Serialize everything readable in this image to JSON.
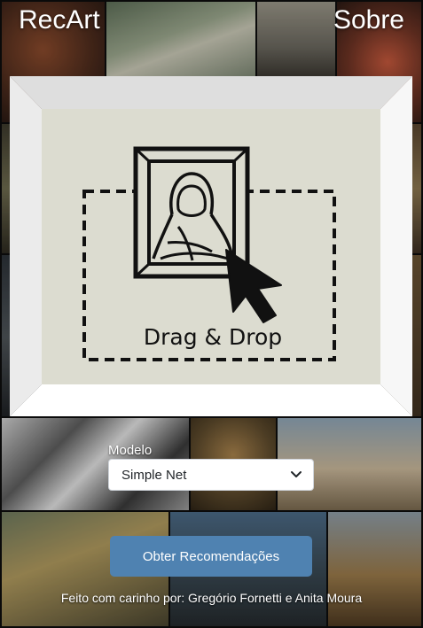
{
  "header": {
    "brand": "RecArt",
    "about_link": "Sobre"
  },
  "drop_zone": {
    "label": "Drag & Drop",
    "icon": "framed-portrait-with-cursor-icon"
  },
  "form": {
    "model_label": "Modelo",
    "model_selected": "Simple Net",
    "submit_label": "Obter Recomendações"
  },
  "footer": {
    "credits": "Feito com carinho por: Gregório Fornetti e Anita Moura"
  },
  "colors": {
    "button": "#4f82b1",
    "frame_outer": "#f2f2f2",
    "canvas": "#dcdcd0"
  }
}
